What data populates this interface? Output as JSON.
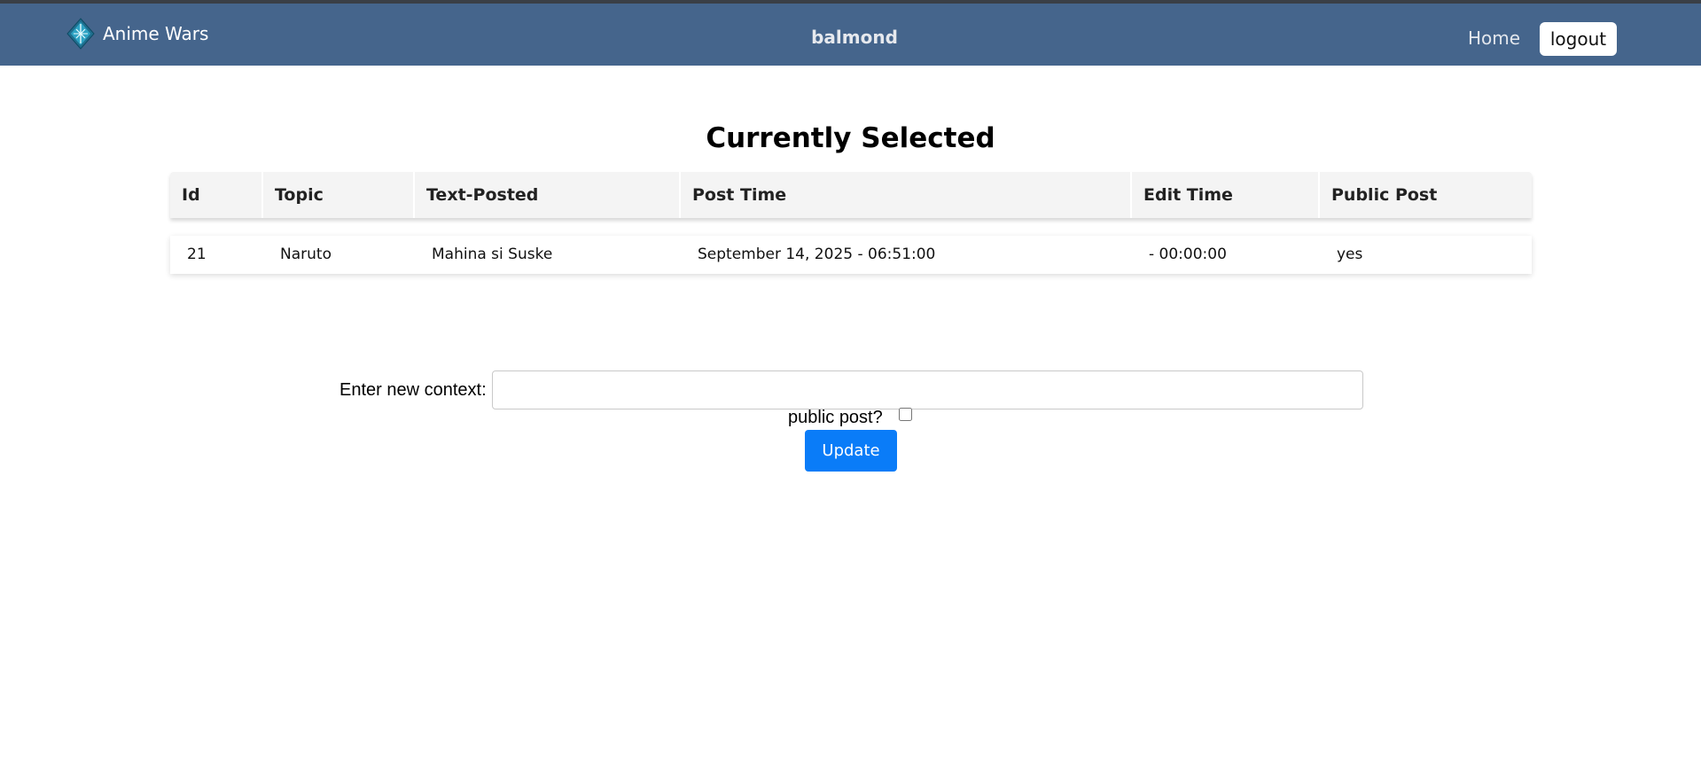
{
  "navbar": {
    "brand_name": "Anime Wars",
    "logo_icon": "anime-wars-diamond-logo",
    "username": "balmond",
    "home_label": "Home",
    "logout_label": "logout",
    "bar_color": "#45658c"
  },
  "main": {
    "title": "Currently Selected",
    "table": {
      "headers": [
        "Id",
        "Topic",
        "Text-Posted",
        "Post Time",
        "Edit Time",
        "Public Post"
      ],
      "rows": [
        [
          "21",
          "Naruto",
          "Mahina si Suske",
          "September 14, 2025 - 06:51:00",
          "- 00:00:00",
          "yes"
        ]
      ]
    }
  },
  "form": {
    "context_label": "Enter new context:",
    "context_value": "",
    "public_label": "public post?",
    "public_checked": false,
    "update_label": "Update",
    "button_color": "#0a7cf8"
  }
}
